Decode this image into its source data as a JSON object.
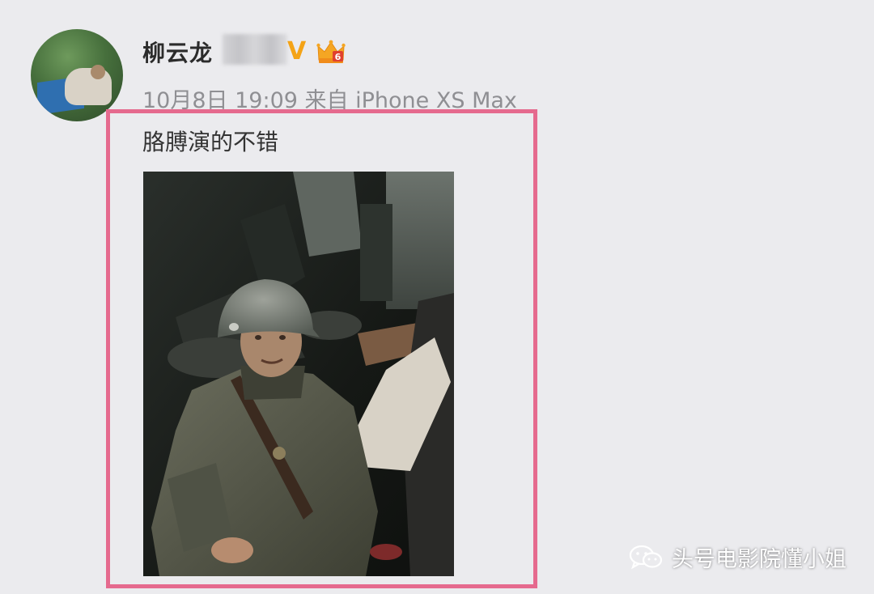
{
  "post": {
    "username": "柳云龙",
    "verified_badge": "V",
    "timestamp": "10月8日 19:09",
    "source_prefix": "来自",
    "source": "iPhone XS Max",
    "text": "胳膊演的不错"
  },
  "icons": {
    "verified": "verified-v-icon",
    "crown": "vip-crown-icon",
    "wechat": "wechat-logo-icon"
  },
  "watermark": {
    "text": "头号电影院懂小姐"
  },
  "colors": {
    "highlight_border": "#e56a8e",
    "verified": "#f4a316",
    "background": "#ebebee"
  }
}
